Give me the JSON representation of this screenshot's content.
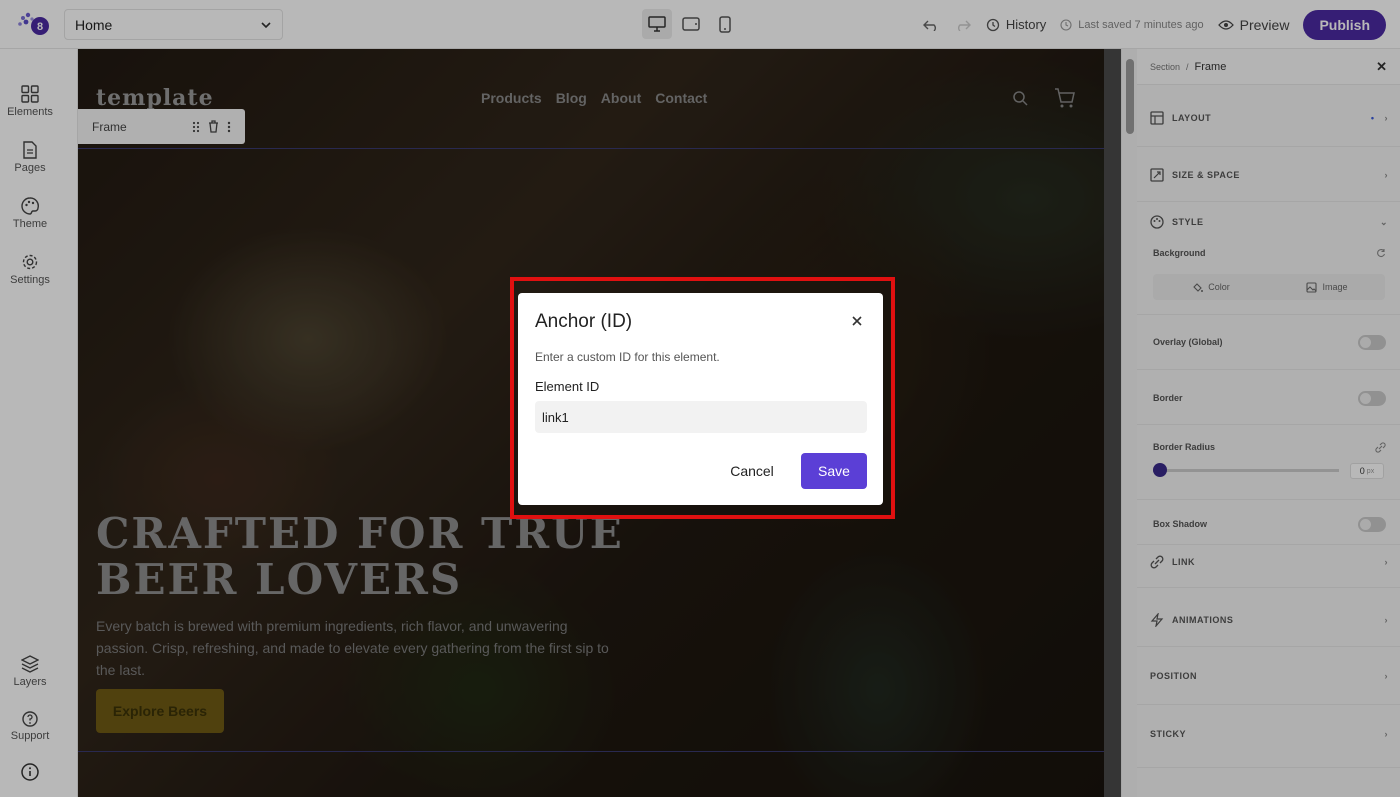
{
  "topbar": {
    "page_select": "Home",
    "history": "History",
    "last_saved": "Last saved 7 minutes ago",
    "preview": "Preview",
    "publish": "Publish"
  },
  "leftbar": {
    "items": [
      {
        "label": "Elements",
        "icon": "grid-icon"
      },
      {
        "label": "Pages",
        "icon": "page-icon"
      },
      {
        "label": "Theme",
        "icon": "palette-icon"
      },
      {
        "label": "Settings",
        "icon": "gear-icon"
      }
    ],
    "bottom": [
      {
        "label": "Layers",
        "icon": "layers-icon"
      },
      {
        "label": "Support",
        "icon": "help-icon"
      },
      {
        "label": "",
        "icon": "info-icon"
      }
    ]
  },
  "site": {
    "logo": "template",
    "nav": [
      "Products",
      "Blog",
      "About",
      "Contact"
    ],
    "frame_tag": "Frame",
    "hero_title": "CRAFTED FOR TRUE BEER LOVERS",
    "hero_text": "Every batch is brewed with premium ingredients, rich flavor, and unwavering passion. Crisp, refreshing, and made to elevate every gathering from the first sip to the last.",
    "hero_button": "Explore Beers"
  },
  "panel": {
    "breadcrumb_root": "Section",
    "breadcrumb_sep": "/",
    "breadcrumb_current": "Frame",
    "sections": {
      "layout": "LAYOUT",
      "size_space": "SIZE & SPACE",
      "style": "STYLE",
      "link": "LINK",
      "animations": "ANIMATIONS",
      "position": "POSITION",
      "sticky": "STICKY"
    },
    "background": "Background",
    "bg_color": "Color",
    "bg_image": "Image",
    "overlay": "Overlay (Global)",
    "border": "Border",
    "border_radius": "Border Radius",
    "border_radius_value": "0",
    "border_radius_unit": "px",
    "box_shadow": "Box Shadow"
  },
  "dialog": {
    "title": "Anchor (ID)",
    "subtitle": "Enter a custom ID for this element.",
    "field_label": "Element ID",
    "field_value": "link1",
    "cancel": "Cancel",
    "save": "Save"
  },
  "colors": {
    "accent": "#5b3fd6",
    "publish": "#4b2aa3",
    "highlight": "#e01010"
  }
}
